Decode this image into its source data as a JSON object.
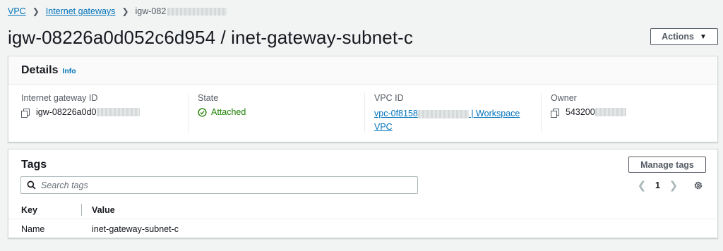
{
  "breadcrumb": {
    "items": [
      "VPC",
      "Internet gateways"
    ],
    "current": "igw-082"
  },
  "title": "igw-08226a0d052c6d954 / inet-gateway-subnet-c",
  "actions_label": "Actions",
  "details": {
    "title": "Details",
    "info_label": "Info",
    "fields": {
      "gateway_id_label": "Internet gateway ID",
      "gateway_id_value": "igw-08226a0d0",
      "state_label": "State",
      "state_value": "Attached",
      "vpc_label": "VPC ID",
      "vpc_value_start": "vpc-0f8158",
      "vpc_value_end": " | Workspace",
      "vpc_value_line2": "VPC",
      "owner_label": "Owner",
      "owner_value": "543200"
    }
  },
  "tags": {
    "title": "Tags",
    "manage_label": "Manage tags",
    "search_placeholder": "Search tags",
    "page_number": "1",
    "columns": [
      "Key",
      "Value"
    ],
    "rows": [
      {
        "key": "Name",
        "value": "inet-gateway-subnet-c"
      }
    ]
  },
  "icons": {
    "copy": "copy-icon",
    "status": "check-circle-icon",
    "search": "search-icon",
    "settings": "gear-icon",
    "caret": "caret-down-icon"
  },
  "colors": {
    "link": "#0073bb",
    "success": "#1d8102",
    "background": "#f2f3f3"
  }
}
